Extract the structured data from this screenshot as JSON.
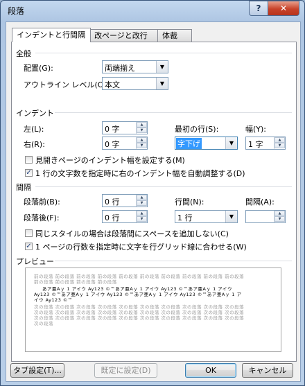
{
  "window": {
    "title": "段落",
    "help": "?",
    "close": "✕"
  },
  "tabs": [
    {
      "label": "インデントと行間隔"
    },
    {
      "label": "改ページと改行"
    },
    {
      "label": "体裁"
    }
  ],
  "general": {
    "heading": "全般",
    "alignment_label": "配置(G):",
    "alignment_value": "両端揃え",
    "outline_label": "アウトライン レベル(O):",
    "outline_value": "本文"
  },
  "indent": {
    "heading": "インデント",
    "left_label": "左(L):",
    "left_value": "0 字",
    "right_label": "右(R):",
    "right_value": "0 字",
    "first_line_label": "最初の行(S):",
    "first_line_value": "字下げ",
    "width_label": "幅(Y):",
    "width_value": "1 字",
    "mirror_label": "見開きページのインデント幅を設定する(M)",
    "mirror_checked": false,
    "auto_adjust_label": "1 行の文字数を指定時に右のインデント幅を自動調整する(D)",
    "auto_adjust_checked": true
  },
  "spacing": {
    "heading": "間隔",
    "before_label": "段落前(B):",
    "before_value": "0 行",
    "after_label": "段落後(F):",
    "after_value": "0 行",
    "line_spacing_label": "行間(N):",
    "line_spacing_value": "1 行",
    "at_label": "間隔(A):",
    "at_value": "",
    "no_space_same_style_label": "同じスタイルの場合は段落間にスペースを追加しない(C)",
    "no_space_same_style_checked": false,
    "grid_label": "1 ページの行数を指定時に文字を行グリッド線に合わせる(W)",
    "grid_checked": true
  },
  "preview": {
    "heading": "プレビュー",
    "prev_lines": [
      "前の段落 前の段落 前の段落 前の段落 前の段落 前の段落 前の段落 前の段落 前の段落 前の段落",
      "前の段落 前の段落 前の段落 前の段落"
    ],
    "sample_lines": [
      "あア亜Aｙ 1 アイウ Ay123 ©™あア亜Aｙ 1 アイウ Ay123 ©™あア亜Aｙ 1 アイウ",
      "Ay123 ©™あア亜Aｙ 1 アイウ Ay123 ©™あア亜Aｙ 1 アイウ Ay123 ©™あア亜Aｙ 1 ア",
      "イウ Ay123 ©™"
    ],
    "next_lines": [
      "次の段落 次の段落 次の段落 次の段落 次の段落 次の段落 次の段落 次の段落 次の段落 次の段落",
      "次の段落 次の段落 次の段落 次の段落 次の段落 次の段落 次の段落 次の段落 次の段落 次の段落",
      "次の段落 次の段落 次の段落 次の段落 次の段落 次の段落 次の段落 次の段落 次の段落 次の段落",
      "次の段落"
    ]
  },
  "buttons": {
    "tabs": "タブ設定(T)...",
    "set_default": "既定に設定(D)",
    "ok": "OK",
    "cancel": "キャンセル"
  }
}
